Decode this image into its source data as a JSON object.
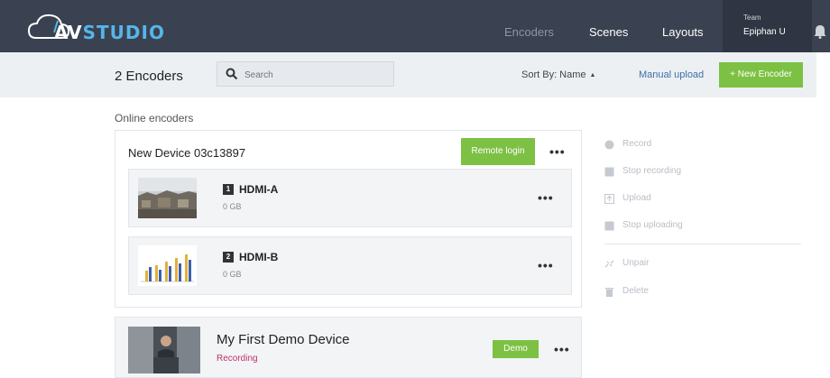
{
  "app": {
    "logo_av": "AV",
    "logo_studio": "STUDIO"
  },
  "nav": {
    "encoders": "Encoders",
    "scenes": "Scenes",
    "layouts": "Layouts",
    "team_label": "Team",
    "team_name": "Epiphan U"
  },
  "toolbar": {
    "encoder_count": "2 Encoders",
    "search_placeholder": "Search",
    "sort_label": "Sort By: Name",
    "manual_upload": "Manual upload",
    "new_encoder": "+ New Encoder"
  },
  "content": {
    "section_title": "Online encoders",
    "device": {
      "name": "New Device 03c13897",
      "remote_login": "Remote login",
      "more": "•••",
      "channels": [
        {
          "number": "1",
          "name": "HDMI-A",
          "size": "0 GB",
          "more": "•••"
        },
        {
          "number": "2",
          "name": "HDMI-B",
          "size": "0 GB",
          "more": "•••"
        }
      ]
    },
    "demo_device": {
      "name": "My First Demo Device",
      "status": "Recording",
      "badge": "Demo",
      "more": "•••"
    }
  },
  "actions": {
    "record": "Record",
    "stop_recording": "Stop recording",
    "upload": "Upload",
    "stop_uploading": "Stop uploading",
    "unpair": "Unpair",
    "delete": "Delete"
  },
  "colors": {
    "topbar": "#3a4150",
    "accent_green": "#7cc143",
    "link_blue": "#3c6fa8",
    "recording": "#c0316b",
    "logo_blue": "#55b5e8"
  },
  "icons": [
    "avstudio-logo-icon",
    "bell-icon",
    "search-icon",
    "record-icon",
    "stop-icon",
    "upload-icon",
    "unpair-icon",
    "trash-icon"
  ]
}
